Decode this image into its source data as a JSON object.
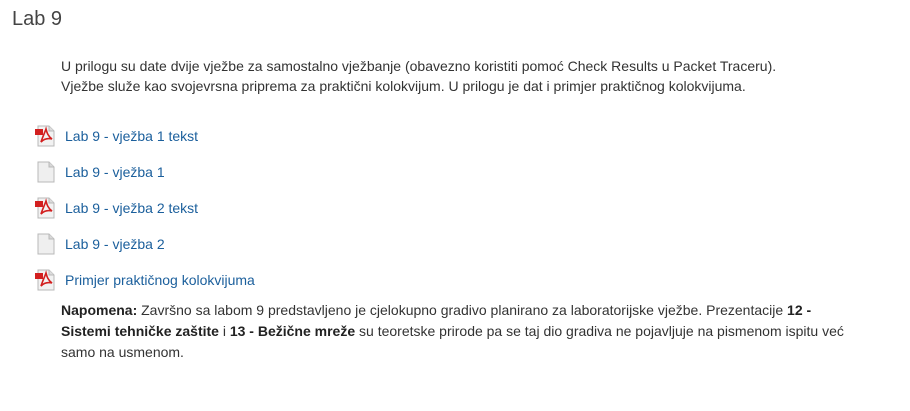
{
  "section": {
    "title": "Lab 9"
  },
  "summary": {
    "line1": "U prilogu su date dvije vježbe za samostalno vježbanje (obavezno koristiti pomoć Check Results u Packet Traceru).",
    "line2": "Vježbe služe kao svojevrsna priprema za praktični kolokvijum. U prilogu je dat i primjer praktičnog kolokvijuma."
  },
  "activities": [
    {
      "label": "Lab 9 - vježba 1 tekst",
      "icon": "pdf-icon"
    },
    {
      "label": "Lab 9 - vježba 1",
      "icon": "file-icon"
    },
    {
      "label": "Lab 9 - vježba 2 tekst",
      "icon": "pdf-icon"
    },
    {
      "label": "Lab 9 - vježba 2",
      "icon": "file-icon"
    },
    {
      "label": "Primjer praktičnog kolokvijuma",
      "icon": "pdf-icon"
    }
  ],
  "note": {
    "label": "Napomena:",
    "text1": " Završno sa labom 9 predstavljeno je cjelokupno gradivo planirano za laboratorijske vježbe. Prezentacije ",
    "bold1": "12 - Sistemi tehničke zaštite",
    "text2": " i ",
    "bold2": "13 - Bežične mreže",
    "text3": " su teoretske prirode pa se taj dio gradiva ne pojavljuje na pismenom ispitu već samo na usmenom."
  },
  "colors": {
    "link": "#1b5f9c",
    "pdf_red": "#d21f1f",
    "text": "#333333"
  }
}
